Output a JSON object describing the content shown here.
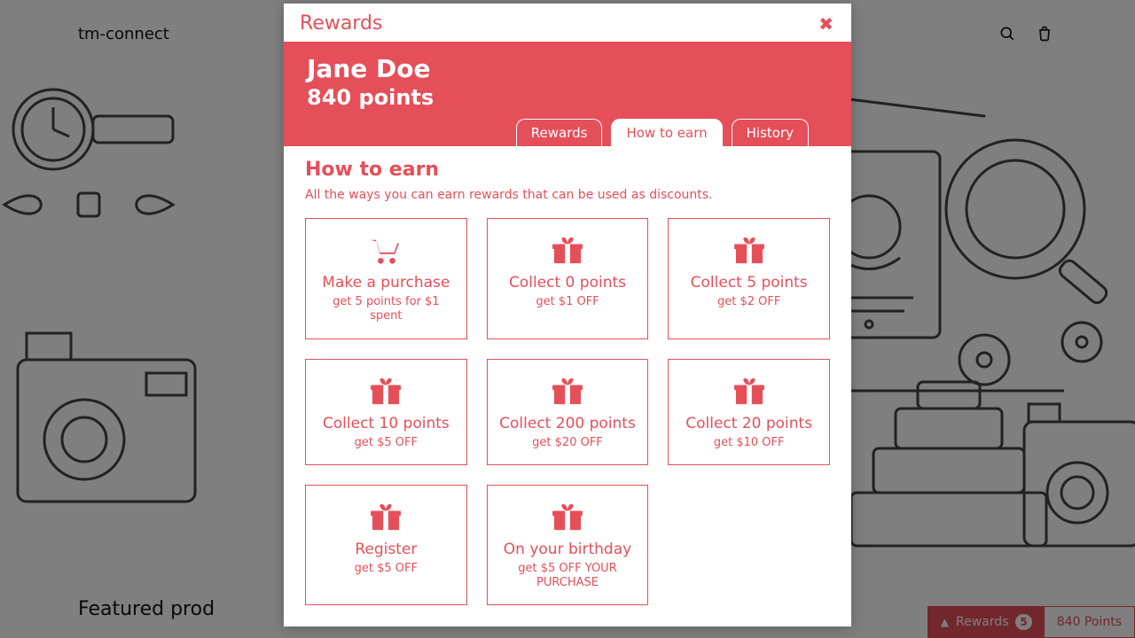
{
  "colors": {
    "accent": "#e54f5a"
  },
  "header": {
    "brand": "tm-connect"
  },
  "featured_label": "Featured prod",
  "rewards_bar": {
    "label": "Rewards",
    "badge": "5",
    "points": "840 Points"
  },
  "modal": {
    "title": "Rewards",
    "user_name": "Jane Doe",
    "user_points": "840 points",
    "tabs": [
      {
        "label": "Rewards",
        "active": false
      },
      {
        "label": "How to earn",
        "active": true
      },
      {
        "label": "History",
        "active": false
      }
    ],
    "section_title": "How to earn",
    "section_subtitle": "All the ways you can earn rewards that can be used as discounts.",
    "cards": [
      {
        "icon": "cart",
        "title": "Make a purchase",
        "desc": "get 5 points for $1 spent"
      },
      {
        "icon": "gift",
        "title": "Collect 0 points",
        "desc": "get $1 OFF"
      },
      {
        "icon": "gift",
        "title": "Collect 5 points",
        "desc": "get $2 OFF"
      },
      {
        "icon": "gift",
        "title": "Collect 10 points",
        "desc": "get $5 OFF"
      },
      {
        "icon": "gift",
        "title": "Collect 200 points",
        "desc": "get $20 OFF"
      },
      {
        "icon": "gift",
        "title": "Collect 20 points",
        "desc": "get $10 OFF"
      },
      {
        "icon": "gift",
        "title": "Register",
        "desc": "get $5 OFF"
      },
      {
        "icon": "gift",
        "title": "On your birthday",
        "desc": "get $5 OFF YOUR PURCHASE"
      }
    ]
  }
}
